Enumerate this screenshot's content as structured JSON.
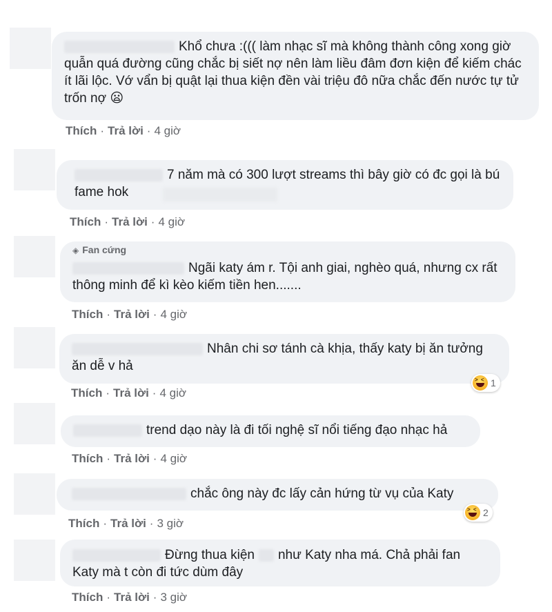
{
  "actions": {
    "like": "Thích",
    "reply": "Trả lời",
    "sep": "·"
  },
  "comments": [
    {
      "text": "Khổ chưa :((( làm nhạc sĩ mà không thành công xong giờ quẫn quá đường cũng chắc bị siết nợ nên làm liều đâm đơn kiện để kiếm chác ít lãi lộc. Vớ vẩn bị quật lại thua kiện đền vài triệu đô nữa chắc đến nước tự tử trốn nợ 😦",
      "time": "4 giờ"
    },
    {
      "text": "7 năm mà có 300 lượt streams thì bây giờ có đc gọi là bú fame hok",
      "time": "4 giờ"
    },
    {
      "badge": "Fan cứng",
      "text": "Ngãi katy ám r. Tội anh giai, nghèo quá, nhưng cx rất thông minh để kì kèo kiếm tiền hen.......",
      "time": "4 giờ"
    },
    {
      "text": "Nhân chi sơ tánh cà khịa, thấy katy bị ăn tưởng ăn dễ v hả",
      "time": "4 giờ",
      "reaction_count": "1"
    },
    {
      "text": "trend dạo này là đi tối nghệ sĩ nổi tiếng đạo nhạc hả",
      "time": "4 giờ"
    },
    {
      "text": "chắc ông này đc lấy cản hứng từ vụ của Katy",
      "time": "3 giờ",
      "reaction_count": "2"
    },
    {
      "text_a": "Đừng thua kiện",
      "text_b": "như Katy nha má. Chả phải fan Katy mà t còn đi tức dùm đây",
      "time": "3 giờ"
    }
  ],
  "icons": {
    "reaction": "haha-icon",
    "badge": "diamond-icon",
    "emoji": "frowning-face-icon"
  },
  "colors": {
    "bubble": "#f0f2f5",
    "meta": "#65676b",
    "text": "#1c1e21"
  }
}
